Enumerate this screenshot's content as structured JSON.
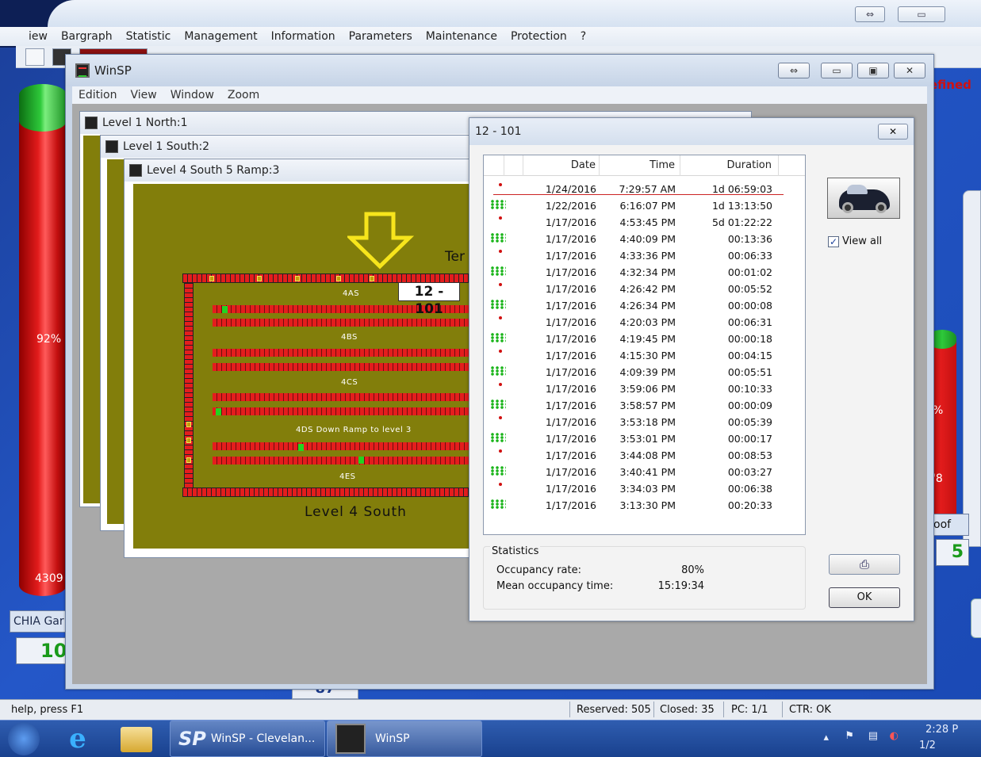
{
  "outer": {
    "menu": [
      "iew",
      "Bargraph",
      "Statistic",
      "Management",
      "Information",
      "Parameters",
      "Maintenance",
      "Protection",
      "?"
    ],
    "left_gauge": {
      "percent": "92%",
      "count": "4309",
      "label": "CHIA Gar",
      "value": "10"
    },
    "right_gauge": {
      "percent": "%",
      "count": "'8",
      "label": "oof",
      "value": "5",
      "header_fragment": "efined"
    },
    "partial_counter": "87"
  },
  "winsp": {
    "title": "WinSP",
    "menu": [
      "Edition",
      "View",
      "Window",
      "Zoom"
    ],
    "children": [
      "Level 1 North:1",
      "Level 1 South:2",
      "Level 4 South 5 Ramp:3"
    ],
    "map": {
      "row_labels": [
        "4AS",
        "4BS",
        "4CS",
        "4DS Down Ramp to level 3",
        "4ES"
      ],
      "title": "Level 4 South",
      "selected_space": "12 - 101",
      "side_text": "Ter"
    }
  },
  "dialog": {
    "title": "12 - 101",
    "columns": [
      "Date",
      "Time",
      "Duration"
    ],
    "rows": [
      {
        "state": "red",
        "date": "1/24/2016",
        "time": "7:29:57 AM",
        "duration": "1d  06:59:03"
      },
      {
        "state": "green",
        "date": "1/22/2016",
        "time": "6:16:07 PM",
        "duration": "1d  13:13:50"
      },
      {
        "state": "red",
        "date": "1/17/2016",
        "time": "4:53:45 PM",
        "duration": "5d  01:22:22"
      },
      {
        "state": "green",
        "date": "1/17/2016",
        "time": "4:40:09 PM",
        "duration": "00:13:36"
      },
      {
        "state": "red",
        "date": "1/17/2016",
        "time": "4:33:36 PM",
        "duration": "00:06:33"
      },
      {
        "state": "green",
        "date": "1/17/2016",
        "time": "4:32:34 PM",
        "duration": "00:01:02"
      },
      {
        "state": "red",
        "date": "1/17/2016",
        "time": "4:26:42 PM",
        "duration": "00:05:52"
      },
      {
        "state": "green",
        "date": "1/17/2016",
        "time": "4:26:34 PM",
        "duration": "00:00:08"
      },
      {
        "state": "red",
        "date": "1/17/2016",
        "time": "4:20:03 PM",
        "duration": "00:06:31"
      },
      {
        "state": "green",
        "date": "1/17/2016",
        "time": "4:19:45 PM",
        "duration": "00:00:18"
      },
      {
        "state": "red",
        "date": "1/17/2016",
        "time": "4:15:30 PM",
        "duration": "00:04:15"
      },
      {
        "state": "green",
        "date": "1/17/2016",
        "time": "4:09:39 PM",
        "duration": "00:05:51"
      },
      {
        "state": "red",
        "date": "1/17/2016",
        "time": "3:59:06 PM",
        "duration": "00:10:33"
      },
      {
        "state": "green",
        "date": "1/17/2016",
        "time": "3:58:57 PM",
        "duration": "00:00:09"
      },
      {
        "state": "red",
        "date": "1/17/2016",
        "time": "3:53:18 PM",
        "duration": "00:05:39"
      },
      {
        "state": "green",
        "date": "1/17/2016",
        "time": "3:53:01 PM",
        "duration": "00:00:17"
      },
      {
        "state": "red",
        "date": "1/17/2016",
        "time": "3:44:08 PM",
        "duration": "00:08:53"
      },
      {
        "state": "green",
        "date": "1/17/2016",
        "time": "3:40:41 PM",
        "duration": "00:03:27"
      },
      {
        "state": "red",
        "date": "1/17/2016",
        "time": "3:34:03 PM",
        "duration": "00:06:38"
      },
      {
        "state": "green",
        "date": "1/17/2016",
        "time": "3:13:30 PM",
        "duration": "00:20:33"
      }
    ],
    "view_all_label": "View all",
    "view_all_checked": true,
    "statistics": {
      "legend": "Statistics",
      "occupancy_rate_label": "Occupancy rate:",
      "occupancy_rate": "80%",
      "mean_time_label": "Mean occupancy time:",
      "mean_time": "15:19:34"
    },
    "ok_label": "OK"
  },
  "statusbar": {
    "help": "help, press F1",
    "reserved": "Reserved: 505",
    "closed": "Closed: 35",
    "pc": "PC: 1/1",
    "ctr": "CTR: OK"
  },
  "taskbar": {
    "tasks": [
      "WinSP - Clevelan...",
      "WinSP"
    ],
    "clock": "2:28 P",
    "date_fragment": "1/2"
  },
  "colors": {
    "occupied": "#e41d1d",
    "free": "#22d422",
    "map_bg": "#827e0b",
    "taskbar": "#19418e"
  }
}
